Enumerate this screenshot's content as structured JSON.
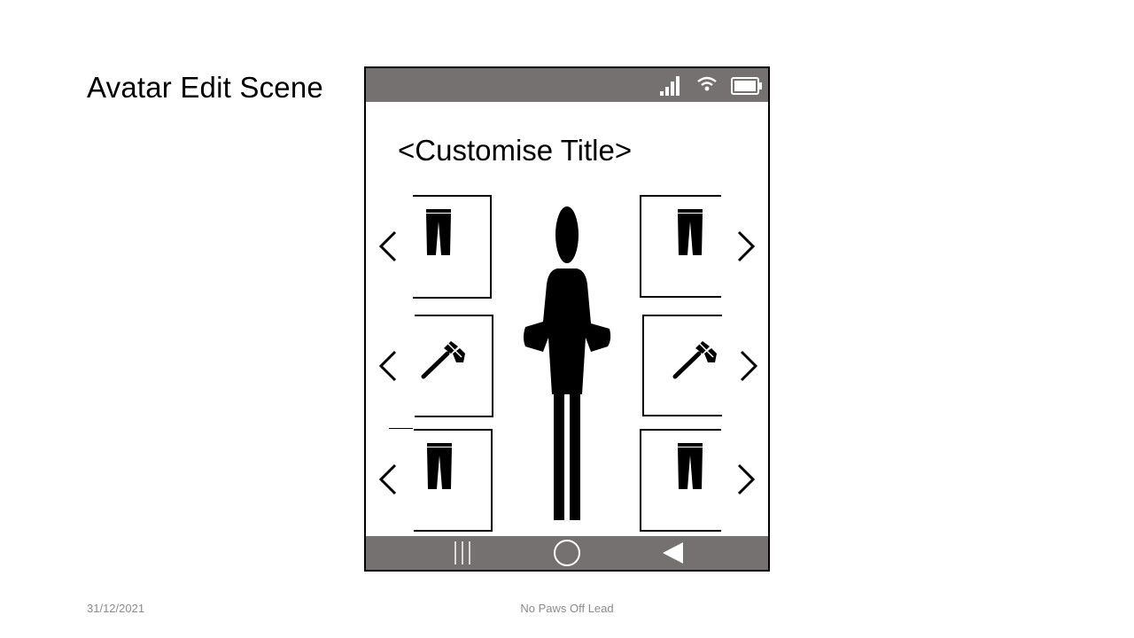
{
  "slide": {
    "title": "Avatar Edit Scene",
    "footer_date": "31/12/2021",
    "footer_center": "No Paws Off Lead"
  },
  "screen": {
    "title": "<Customise Title>"
  },
  "status_bar": {
    "icons": [
      "signal-icon",
      "wifi-icon",
      "battery-icon"
    ],
    "color": "#767171"
  },
  "nav_bar": {
    "icons": [
      "recent-apps-icon",
      "home-icon",
      "back-icon"
    ],
    "color": "#767171"
  },
  "customiser": {
    "rows": [
      {
        "left_item": "trousers-icon",
        "right_item": "trousers-icon"
      },
      {
        "left_item": "brush-icon",
        "right_item": "brush-icon"
      },
      {
        "left_item": "trousers-icon",
        "right_item": "trousers-icon"
      }
    ],
    "avatar": "person-silhouette"
  }
}
